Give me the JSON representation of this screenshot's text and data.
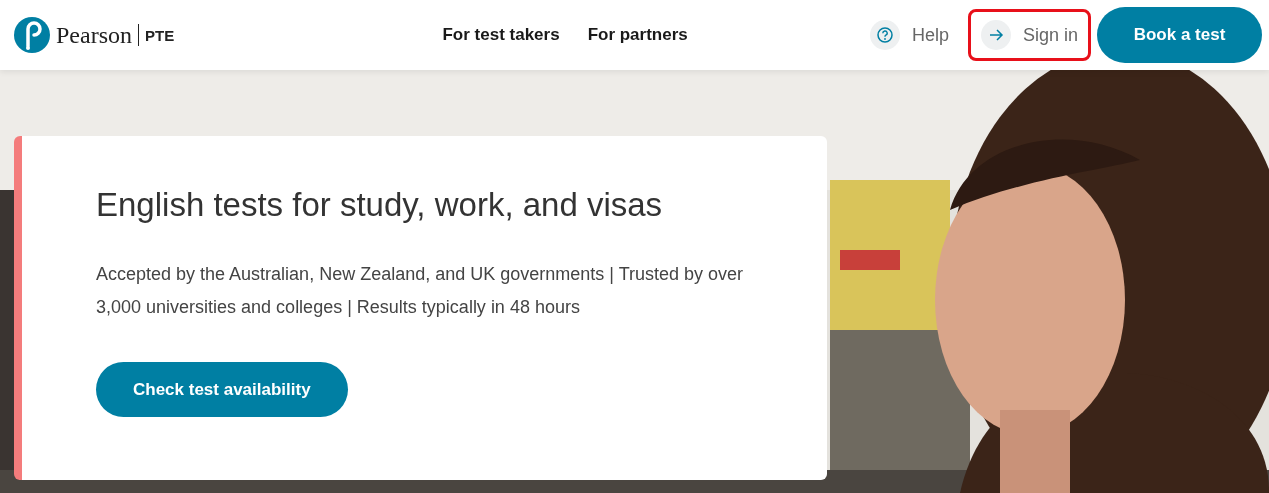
{
  "header": {
    "brand": "Pearson",
    "product": "PTE",
    "nav": [
      {
        "label": "For test takers"
      },
      {
        "label": "For partners"
      }
    ],
    "actions": [
      {
        "kind": "help",
        "label": "Help",
        "highlighted": false
      },
      {
        "kind": "signin",
        "label": "Sign in",
        "highlighted": true
      }
    ],
    "cta": "Book a test"
  },
  "hero": {
    "title": "English tests for study, work, and visas",
    "text": "Accepted by the Australian, New Zealand, and UK governments | Trusted by over 3,000 universities and colleges | Results typically in 48 hours",
    "button": "Check test availability"
  }
}
